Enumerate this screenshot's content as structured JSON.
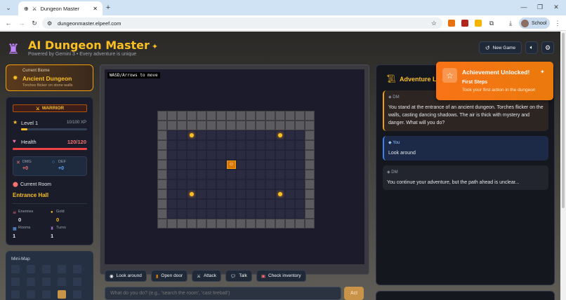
{
  "browser": {
    "tab_title": "Dungeon Master",
    "url": "dungeonmaster.elpeef.com",
    "profile_label": "School"
  },
  "header": {
    "title": "AI Dungeon Master",
    "subtitle": "Powered by Gemini 3 • Every adventure is unique",
    "new_game_label": "New Game"
  },
  "biome": {
    "label": "Current Biome",
    "name": "Ancient Dungeon",
    "description": "Torches flicker on stone walls"
  },
  "stats": {
    "class_label": "WARRIOR",
    "level_label": "Level 1",
    "xp": "10/100 XP",
    "xp_fraction": 0.1,
    "health_label": "Health",
    "health_value": "120/120",
    "health_fraction": 1.0,
    "dmg_label": "DMG",
    "dmg_value": "+0",
    "def_label": "DEF",
    "def_value": "+0",
    "room_label": "Current Room",
    "room_name": "Entrance Hall",
    "enemies_label": "Enemies",
    "enemies_value": "0",
    "gold_label": "Gold",
    "gold_value": "0",
    "rooms_label": "Rooms",
    "rooms_value": "1",
    "turns_label": "Turns",
    "turns_value": "1"
  },
  "minimap": {
    "label": "Mini-Map"
  },
  "game": {
    "hint": "WASD/Arrows to move"
  },
  "actions": [
    {
      "label": "Look around"
    },
    {
      "label": "Open door"
    },
    {
      "label": "Attack"
    },
    {
      "label": "Talk"
    },
    {
      "label": "Check inventory"
    }
  ],
  "input": {
    "placeholder": "What do you do? (e.g., 'search the room', 'cast fireball')",
    "submit_label": "Act"
  },
  "log": {
    "title": "Adventure Lo",
    "messages": [
      {
        "speaker": "DM",
        "text": "You stand at the entrance of an ancient dungeon. Torches flicker on the walls, casting dancing shadows. The air is thick with mystery and danger. What will you do?"
      },
      {
        "speaker": "You",
        "text": "Look around"
      },
      {
        "speaker": "DM",
        "text": "You continue your adventure, but the path ahead is unclear..."
      }
    ]
  },
  "toast": {
    "heading": "Achievement Unlocked!",
    "name": "First Steps",
    "description": "Took your first action in the dungeon"
  },
  "colors": {
    "accent": "#fbbf24",
    "toast": "#f97316",
    "health": "#f87171"
  }
}
